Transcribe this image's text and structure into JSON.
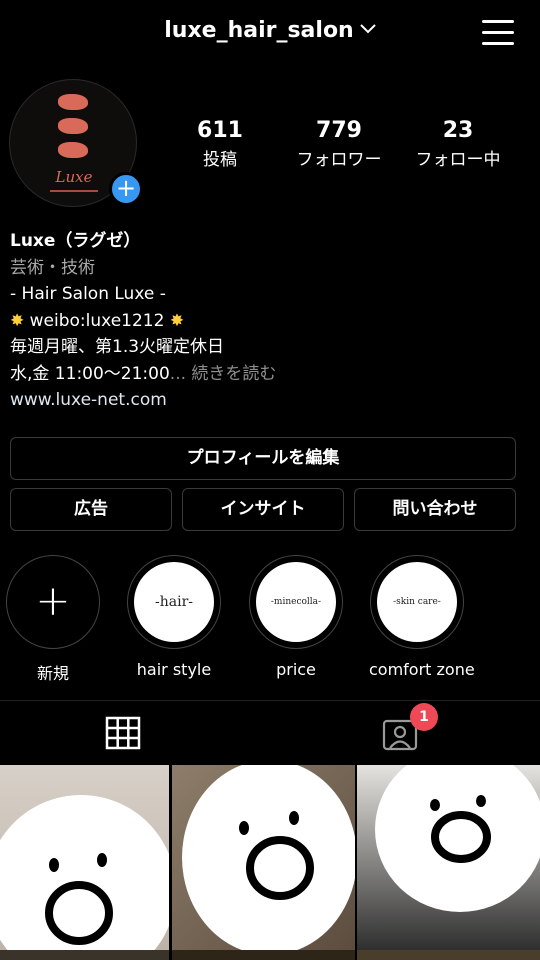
{
  "header": {
    "username": "luxe_hair_salon",
    "dropdown_icon": "chevron-down-icon",
    "menu_icon": "hamburger-menu-icon"
  },
  "profile": {
    "avatar_logo_text": "Luxe",
    "stats": [
      {
        "value": "611",
        "label": "投稿"
      },
      {
        "value": "779",
        "label": "フォロワー"
      },
      {
        "value": "23",
        "label": "フォロー中"
      }
    ]
  },
  "bio": {
    "name": "Luxe（ラグゼ）",
    "category": "芸術・技術",
    "line1": "- Hair Salon Luxe -",
    "line2": "weibo:luxe1212",
    "line3": "毎週月曜、第1.3火曜定休日",
    "line4": "水,金 11:00〜21:00",
    "ellipsis": "...",
    "more": "続きを読む",
    "link": "www.luxe-net.com"
  },
  "buttons": {
    "edit_profile": "プロフィールを編集",
    "ads": "広告",
    "insights": "インサイト",
    "contact": "問い合わせ"
  },
  "highlights": [
    {
      "label": "新規",
      "cover": ""
    },
    {
      "label": "hair style",
      "cover": "-hair-"
    },
    {
      "label": "price",
      "cover": "-minecolla-"
    },
    {
      "label": "comfort zone",
      "cover": "-skin care-"
    }
  ],
  "tabs": {
    "tagged_badge": "1"
  },
  "colors": {
    "background": "#000000",
    "accent_blue": "#3897f0",
    "badge_red": "#ed4956",
    "logo_red": "#d96a5a"
  }
}
